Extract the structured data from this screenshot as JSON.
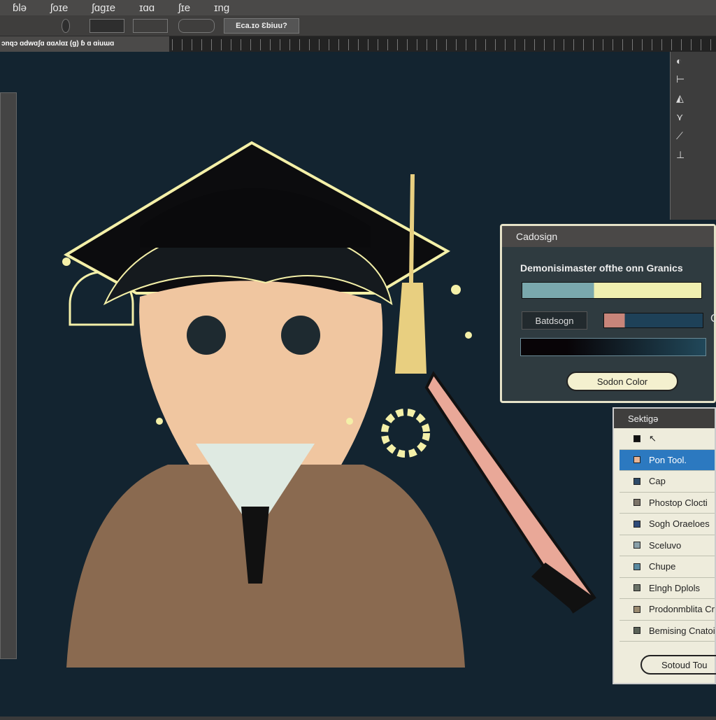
{
  "menu": [
    "ɓlə",
    "ʃoɪe",
    "ʃɑɡɪe",
    "ɪɑɑ",
    "ʃɪe",
    "ɪnɡ"
  ],
  "options": {
    "button_label": "Eca.ɪo Ɛbiuu?"
  },
  "document_tab": "ɔnqɔ ɑdwɑʃɑ ɑɑʌlɑɪ (ɡ) ɓ ɑ ɑiuɯɑ",
  "right_tools": [
    "◐",
    "⊢",
    "◭",
    "⋎",
    "⟋",
    "⊥"
  ],
  "dialog": {
    "title": "Cadosign",
    "description": "Demonisimaster ofthe onn Granics",
    "button_small": "Batdsogn",
    "side_letter": "C",
    "select_button": "Sodon Color"
  },
  "tool_list": {
    "title": "Sektigə",
    "items": [
      {
        "label": "↖",
        "color": "#111111"
      },
      {
        "label": "Pon Tool.",
        "color": "#e9b595",
        "selected": true
      },
      {
        "label": "Cap",
        "color": "#2e4a68"
      },
      {
        "label": "Phostop Clocti",
        "color": "#7c7468"
      },
      {
        "label": "Sogh Oraeloes",
        "color": "#2e4a78"
      },
      {
        "label": "Sceluvo",
        "color": "#8aa0a8"
      },
      {
        "label": "Chupe",
        "color": "#5a8aa0"
      },
      {
        "label": "Elngh Dplols",
        "color": "#6a7268"
      },
      {
        "label": "Prodonmblita Cr",
        "color": "#9a8a70"
      },
      {
        "label": "Bemising Cnatoi",
        "color": "#5a6258"
      }
    ],
    "button": "Sotoud Tou"
  },
  "colors": {
    "canvas": "#132430",
    "highlight": "#2c79c0",
    "glow": "#f4f0a8"
  }
}
